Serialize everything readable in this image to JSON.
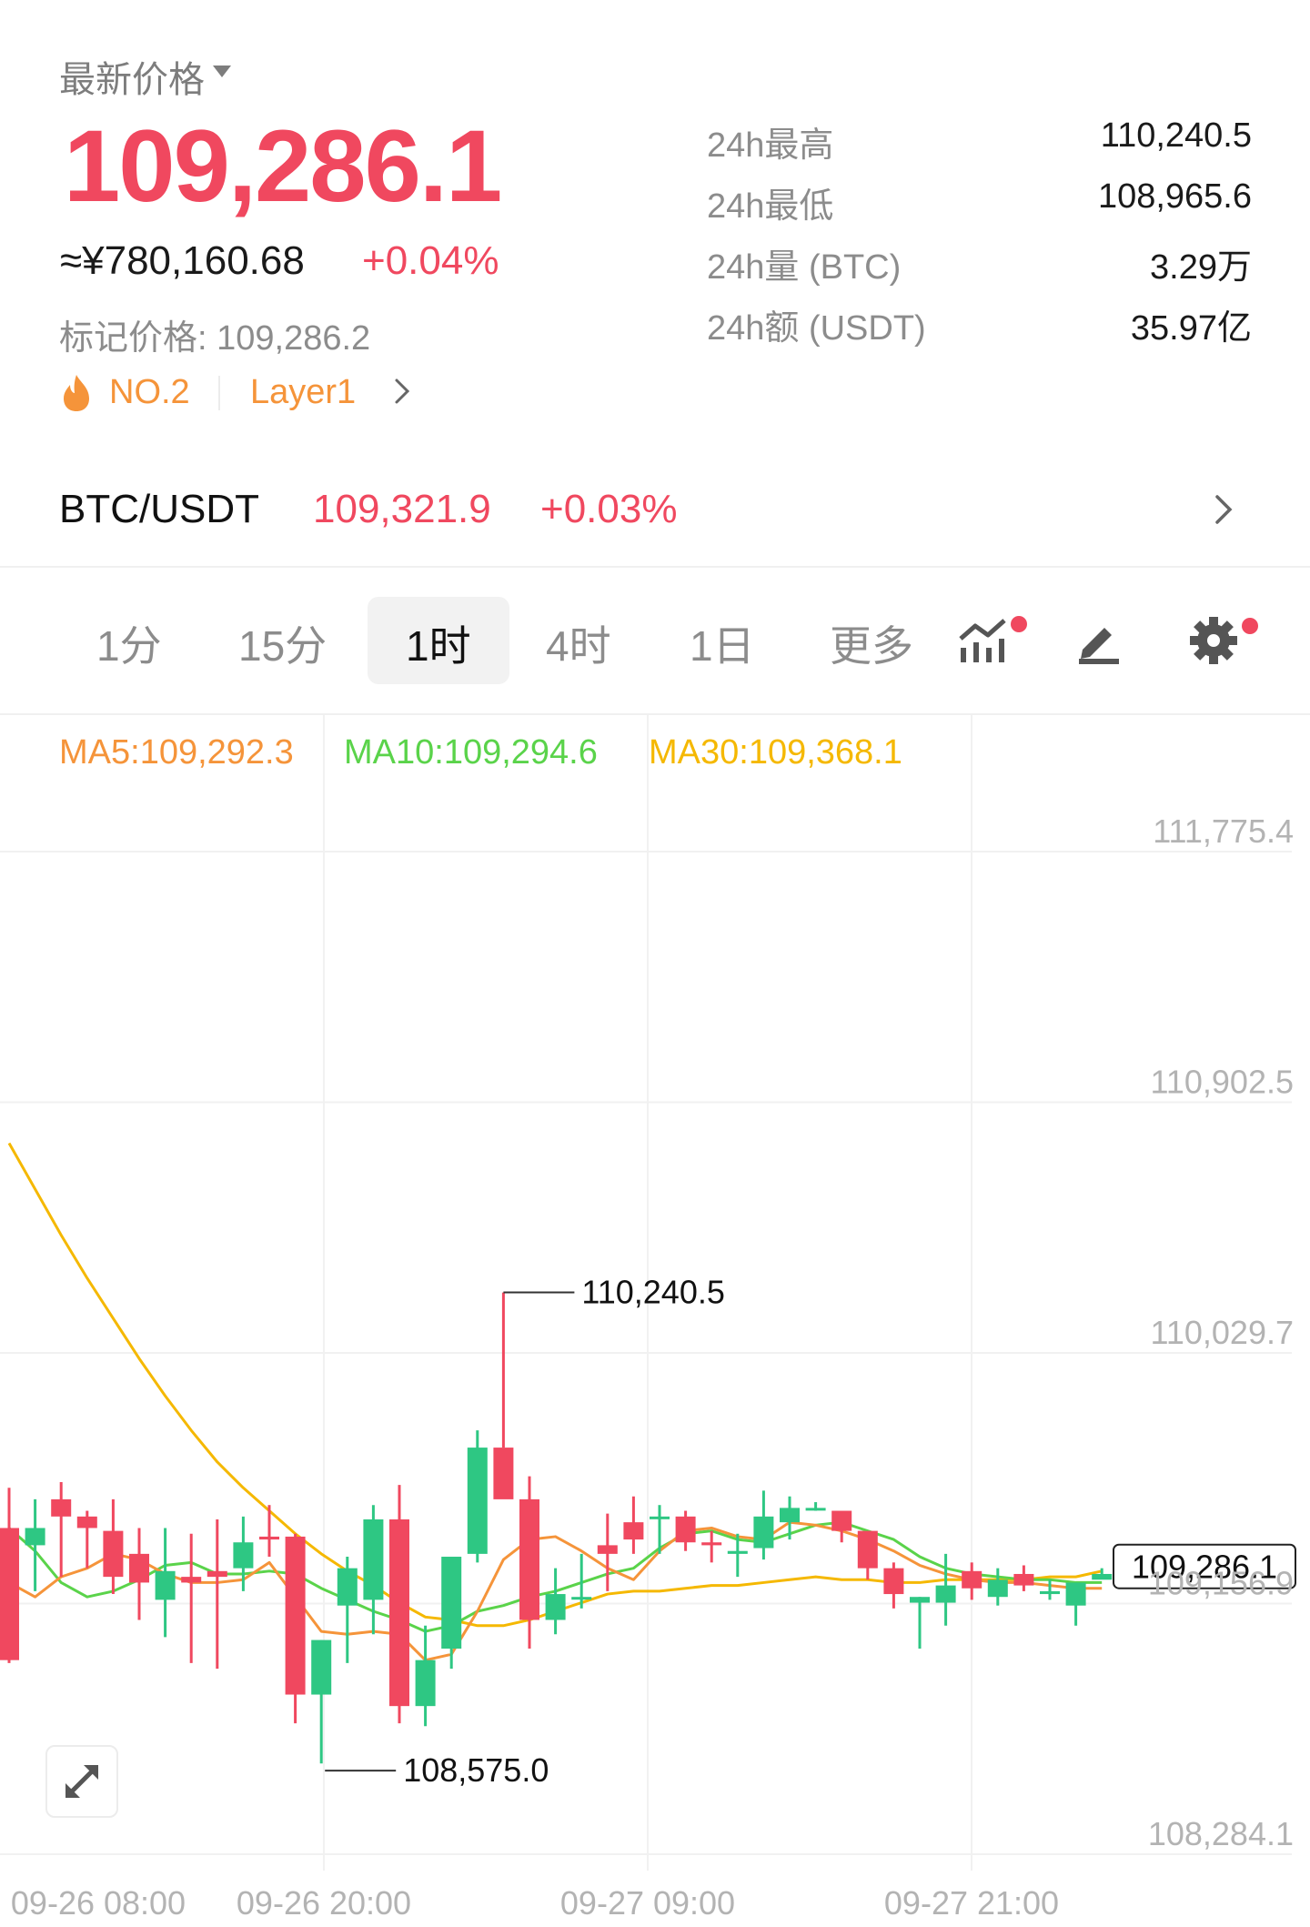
{
  "header": {
    "latest_label": "最新价格",
    "price": "109,286.1",
    "cny_value": "≈¥780,160.68",
    "change_pct": "+0.04%",
    "mark_price": "标记价格: 109,286.2",
    "rank": "NO.2",
    "sector": "Layer1"
  },
  "stats": [
    {
      "label": "24h最高",
      "value": "110,240.5"
    },
    {
      "label": "24h最低",
      "value": "108,965.6"
    },
    {
      "label": "24h量 (BTC)",
      "value": "3.29万"
    },
    {
      "label": "24h额 (USDT)",
      "value": "35.97亿"
    }
  ],
  "pair": {
    "name": "BTC/USDT",
    "price": "109,321.9",
    "change": "+0.03%"
  },
  "tabs": [
    "1分",
    "15分",
    "1时",
    "4时",
    "1日",
    "更多"
  ],
  "active_tab": "1时",
  "toolbar_icons": [
    "indicator-icon",
    "draw-icon",
    "settings-icon"
  ],
  "ma": {
    "ma5": "MA5:109,292.3",
    "ma10": "MA10:109,294.6",
    "ma30": "MA30:109,368.1"
  },
  "colors": {
    "up": "#f0485f",
    "down": "#2ec783",
    "ma5": "#f5943a",
    "ma10": "#5ad34a",
    "ma30": "#f5b800",
    "accent_orange": "#f5943a"
  },
  "chart_data": {
    "type": "candlestick",
    "interval": "1h",
    "y_ticks": [
      "111,775.4",
      "110,902.5",
      "110,029.7",
      "109,156.9",
      "108,284.1"
    ],
    "ylim": [
      108284.1,
      111775.4
    ],
    "x_ticks": [
      "09-26 08:00",
      "09-26 20:00",
      "09-27 09:00",
      "09-27 21:00"
    ],
    "annotations": {
      "high": "110,240.5",
      "low": "108,575.0",
      "last": "109,286.1"
    },
    "candles": [
      {
        "o": 109420,
        "h": 109560,
        "l": 108950,
        "c": 108960
      },
      {
        "o": 109360,
        "h": 109520,
        "l": 109200,
        "c": 109420
      },
      {
        "o": 109520,
        "h": 109580,
        "l": 109250,
        "c": 109460
      },
      {
        "o": 109460,
        "h": 109480,
        "l": 109280,
        "c": 109420
      },
      {
        "o": 109410,
        "h": 109520,
        "l": 109190,
        "c": 109250
      },
      {
        "o": 109330,
        "h": 109420,
        "l": 109100,
        "c": 109230
      },
      {
        "o": 109170,
        "h": 109420,
        "l": 109040,
        "c": 109270
      },
      {
        "o": 109250,
        "h": 109400,
        "l": 108950,
        "c": 109230
      },
      {
        "o": 109270,
        "h": 109450,
        "l": 108930,
        "c": 109250
      },
      {
        "o": 109280,
        "h": 109460,
        "l": 109200,
        "c": 109370
      },
      {
        "o": 109390,
        "h": 109500,
        "l": 109320,
        "c": 109380
      },
      {
        "o": 109390,
        "h": 109400,
        "l": 108740,
        "c": 108840
      },
      {
        "o": 108840,
        "h": 109030,
        "l": 108600,
        "c": 109030
      },
      {
        "o": 109150,
        "h": 109320,
        "l": 108950,
        "c": 109280
      },
      {
        "o": 109170,
        "h": 109500,
        "l": 109050,
        "c": 109450
      },
      {
        "o": 109450,
        "h": 109570,
        "l": 108740,
        "c": 108800
      },
      {
        "o": 108800,
        "h": 109080,
        "l": 108730,
        "c": 108960
      },
      {
        "o": 109000,
        "h": 109300,
        "l": 108930,
        "c": 109320
      },
      {
        "o": 109330,
        "h": 109760,
        "l": 109300,
        "c": 109700
      },
      {
        "o": 109700,
        "h": 110240,
        "l": 109700,
        "c": 109520
      },
      {
        "o": 109520,
        "h": 109600,
        "l": 109000,
        "c": 109100
      },
      {
        "o": 109100,
        "h": 109280,
        "l": 109050,
        "c": 109190
      },
      {
        "o": 109180,
        "h": 109330,
        "l": 109140,
        "c": 109180
      },
      {
        "o": 109360,
        "h": 109470,
        "l": 109200,
        "c": 109330
      },
      {
        "o": 109440,
        "h": 109530,
        "l": 109330,
        "c": 109380
      },
      {
        "o": 109460,
        "h": 109500,
        "l": 109330,
        "c": 109460
      },
      {
        "o": 109460,
        "h": 109480,
        "l": 109340,
        "c": 109370
      },
      {
        "o": 109370,
        "h": 109410,
        "l": 109300,
        "c": 109360
      },
      {
        "o": 109330,
        "h": 109400,
        "l": 109250,
        "c": 109340
      },
      {
        "o": 109350,
        "h": 109550,
        "l": 109310,
        "c": 109460
      },
      {
        "o": 109440,
        "h": 109530,
        "l": 109380,
        "c": 109490
      },
      {
        "o": 109490,
        "h": 109510,
        "l": 109480,
        "c": 109490
      },
      {
        "o": 109480,
        "h": 109470,
        "l": 109370,
        "c": 109410
      },
      {
        "o": 109410,
        "h": 109400,
        "l": 109240,
        "c": 109280
      },
      {
        "o": 109280,
        "h": 109300,
        "l": 109140,
        "c": 109190
      },
      {
        "o": 109160,
        "h": 109180,
        "l": 109000,
        "c": 109180
      },
      {
        "o": 109160,
        "h": 109330,
        "l": 109080,
        "c": 109220
      },
      {
        "o": 109270,
        "h": 109300,
        "l": 109170,
        "c": 109210
      },
      {
        "o": 109180,
        "h": 109280,
        "l": 109150,
        "c": 109240
      },
      {
        "o": 109260,
        "h": 109290,
        "l": 109200,
        "c": 109220
      },
      {
        "o": 109190,
        "h": 109240,
        "l": 109170,
        "c": 109200
      },
      {
        "o": 109150,
        "h": 109230,
        "l": 109080,
        "c": 109230
      },
      {
        "o": 109240,
        "h": 109280,
        "l": 109260,
        "c": 109260
      }
    ],
    "ma5": [
      109230,
      109180,
      109250,
      109280,
      109330,
      109310,
      109260,
      109230,
      109230,
      109240,
      109300,
      109180,
      109060,
      109050,
      109060,
      109050,
      108960,
      108980,
      109130,
      109310,
      109380,
      109390,
      109340,
      109280,
      109240,
      109340,
      109410,
      109420,
      109390,
      109380,
      109440,
      109430,
      109410,
      109380,
      109340,
      109290,
      109260,
      109240,
      109230,
      109230,
      109220,
      109210,
      109210
    ],
    "ma10": [
      109420,
      109340,
      109230,
      109180,
      109200,
      109240,
      109290,
      109300,
      109260,
      109260,
      109270,
      109260,
      109210,
      109170,
      109130,
      109100,
      109060,
      109080,
      109130,
      109150,
      109180,
      109200,
      109230,
      109260,
      109280,
      109350,
      109400,
      109410,
      109380,
      109370,
      109400,
      109430,
      109440,
      109410,
      109380,
      109320,
      109280,
      109260,
      109250,
      109240,
      109240,
      109230,
      109230
    ],
    "ma30": [
      110760,
      110600,
      110440,
      110290,
      110150,
      110010,
      109880,
      109760,
      109650,
      109560,
      109480,
      109400,
      109330,
      109270,
      109220,
      109160,
      109110,
      109100,
      109080,
      109080,
      109100,
      109130,
      109160,
      109190,
      109200,
      109200,
      109210,
      109220,
      109220,
      109230,
      109240,
      109250,
      109240,
      109240,
      109230,
      109230,
      109240,
      109240,
      109240,
      109240,
      109250,
      109250,
      109270
    ]
  }
}
